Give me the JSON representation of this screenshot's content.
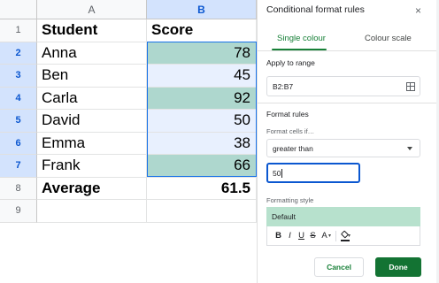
{
  "sheet": {
    "columns": [
      "A",
      "B"
    ],
    "rows": [
      {
        "num": "1",
        "a": "Student",
        "b": "Score",
        "header": true
      },
      {
        "num": "2",
        "a": "Anna",
        "b": "78",
        "highlight": true
      },
      {
        "num": "3",
        "a": "Ben",
        "b": "45",
        "highlight": false
      },
      {
        "num": "4",
        "a": "Carla",
        "b": "92",
        "highlight": true
      },
      {
        "num": "5",
        "a": "David",
        "b": "50",
        "highlight": false
      },
      {
        "num": "6",
        "a": "Emma",
        "b": "38",
        "highlight": false
      },
      {
        "num": "7",
        "a": "Frank",
        "b": "66",
        "highlight": true
      },
      {
        "num": "8",
        "a": "Average",
        "b": "61.5",
        "header": true
      },
      {
        "num": "9",
        "a": "",
        "b": ""
      }
    ]
  },
  "panel": {
    "title": "Conditional format rules",
    "close_label": "×",
    "tabs": {
      "single": "Single colour",
      "scale": "Colour scale"
    },
    "apply_label": "Apply to range",
    "range_value": "B2:B7",
    "format_rules_label": "Format rules",
    "format_cells_if_label": "Format cells if…",
    "condition": "greater than",
    "value": "50",
    "formatting_style_label": "Formatting style",
    "style_preview": "Default",
    "toolbar": {
      "bold": "B",
      "italic": "I",
      "underline": "U",
      "strike": "S",
      "text_color": "A",
      "caret": "▾"
    },
    "cancel_label": "Cancel",
    "done_label": "Done"
  },
  "colors": {
    "highlight": "#aed7ce",
    "selected_range": "#e8f0fe",
    "accent_green": "#188038",
    "done_green": "#137333",
    "style_preview_bg": "#b7e1cd",
    "selection_blue": "#1a73e8"
  },
  "icons": {
    "close": "close-icon",
    "grid": "grid-select-icon",
    "dropdown": "chevron-down-icon",
    "fill": "fill-color-icon"
  }
}
